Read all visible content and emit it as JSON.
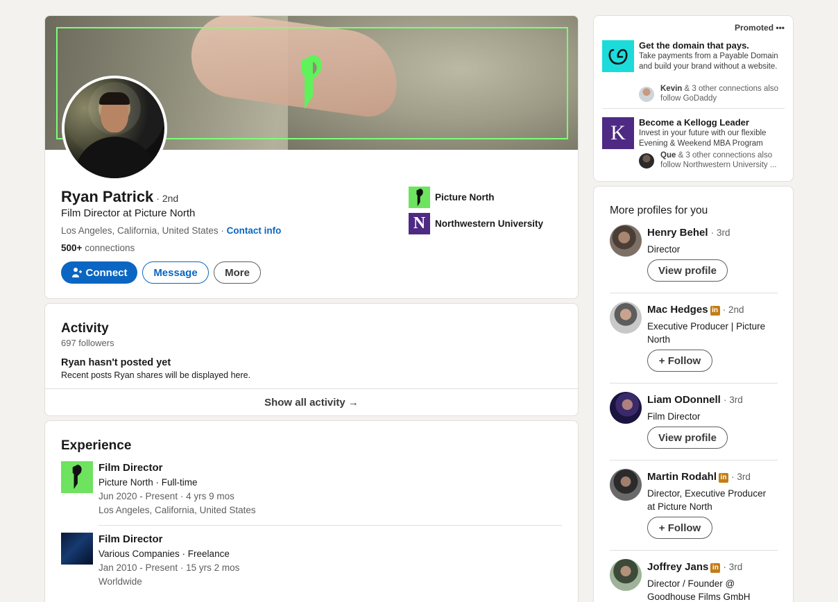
{
  "profile": {
    "name": "Ryan Patrick",
    "degree": "· 2nd",
    "headline": "Film Director at Picture North",
    "location": "Los Angeles, California, United States ·",
    "contact_label": "Contact info",
    "connections_count": "500+",
    "connections_label": "connections",
    "buttons": {
      "connect": "Connect",
      "message": "Message",
      "more": "More"
    },
    "orgs": [
      {
        "name": "Picture North",
        "color": "#6ee35f"
      },
      {
        "name": "Northwestern University",
        "color": "#4e2a84",
        "letter": "N"
      }
    ]
  },
  "activity": {
    "title": "Activity",
    "followers": "697 followers",
    "empty_title": "Ryan hasn't posted yet",
    "empty_body": "Recent posts Ryan shares will be displayed here.",
    "show_all": "Show all activity →"
  },
  "experience": {
    "title": "Experience",
    "items": [
      {
        "title": "Film Director",
        "company": "Picture North · Full-time",
        "dates": "Jun 2020 - Present · 4 yrs 9 mos",
        "location": "Los Angeles, California, United States"
      },
      {
        "title": "Film Director",
        "company": "Various Companies · Freelance",
        "dates": "Jan 2010 - Present · 15 yrs 2 mos",
        "location": "Worldwide"
      }
    ]
  },
  "promoted": {
    "label": "Promoted",
    "more_icon": "•••",
    "ads": [
      {
        "title": "Get the domain that pays.",
        "body": "Take payments from a Payable Domain and build your brand without a website.",
        "social_name": "Kevin",
        "social_text": "& 3 other connections also follow GoDaddy",
        "brand_color": "#1bdbdb"
      },
      {
        "title": "Become a Kellogg Leader",
        "body": "Invest in your future with our flexible Evening & Weekend MBA Program",
        "social_name": "Que",
        "social_text": "& 3 other connections also follow Northwestern University ...",
        "brand_color": "#4e2a84",
        "letter": "K"
      }
    ]
  },
  "more_profiles": {
    "title": "More profiles for you",
    "items": [
      {
        "name": "Henry Behel",
        "degree": "· 3rd",
        "headline": "Director",
        "action": "View profile"
      },
      {
        "name": "Mac Hedges",
        "badge": "in",
        "degree": "· 2nd",
        "headline": "Executive Producer | Picture North",
        "action": "+ Follow"
      },
      {
        "name": "Liam ODonnell",
        "degree": "· 3rd",
        "headline": "Film Director",
        "action": "View profile"
      },
      {
        "name": "Martin Rodahl",
        "badge": "in",
        "degree": "· 3rd",
        "headline": "Director, Executive Producer at Picture North",
        "action": "+ Follow"
      },
      {
        "name": "Joffrey Jans",
        "badge": "in",
        "degree": "· 3rd",
        "headline": "Director / Founder @ Goodhouse Films GmbH",
        "action": ""
      }
    ]
  }
}
